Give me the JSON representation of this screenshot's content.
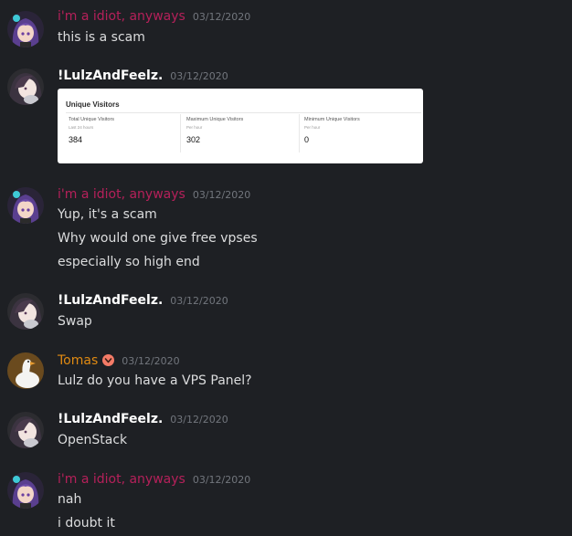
{
  "messages": [
    {
      "author": "i'm a idiot, anyways",
      "timestamp": "03/12/2020",
      "lines": [
        "this is a scam"
      ]
    },
    {
      "author": "!LulzAndFeelz.",
      "timestamp": "03/12/2020",
      "lines": [],
      "embed": {
        "title": "Unique Visitors",
        "stats": [
          {
            "label": "Total Unique Visitors",
            "sub": "Last 24 hours",
            "value": "384"
          },
          {
            "label": "Maximum Unique Visitors",
            "sub": "Per hour",
            "value": "302"
          },
          {
            "label": "Minimum Unique Visitors",
            "sub": "Per hour",
            "value": "0"
          }
        ]
      }
    },
    {
      "author": "i'm a idiot, anyways",
      "timestamp": "03/12/2020",
      "lines": [
        "Yup, it's a scam",
        "Why would one give free vpses",
        "especially so high end"
      ]
    },
    {
      "author": "!LulzAndFeelz.",
      "timestamp": "03/12/2020",
      "lines": [
        "Swap"
      ]
    },
    {
      "author": "Tomas",
      "timestamp": "03/12/2020",
      "lines": [
        "Lulz do you have a VPS Panel?"
      ]
    },
    {
      "author": "!LulzAndFeelz.",
      "timestamp": "03/12/2020",
      "lines": [
        "OpenStack"
      ]
    },
    {
      "author": "i'm a idiot, anyways",
      "timestamp": "03/12/2020",
      "lines": [
        "nah",
        "i doubt it"
      ]
    }
  ],
  "colors": {
    "background": "#1e2024",
    "idiot_name": "#b5205a",
    "tomas_name": "#e08a12",
    "lulz_name": "#ffffff",
    "timestamp": "#72767d",
    "message_text": "#dcddde",
    "badge": "#f47b67"
  },
  "icons": {
    "avatar_idiot": "anime-girl-avatar-icon",
    "avatar_lulz": "anime-girl-avatar-icon",
    "avatar_tomas": "goose-avatar-icon",
    "tomas_badge": "heart-badge-icon"
  }
}
